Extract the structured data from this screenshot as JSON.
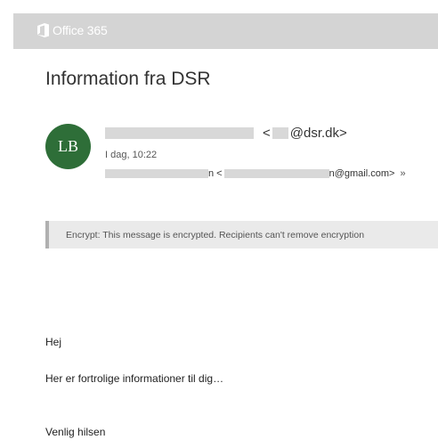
{
  "topbar": {
    "brand": "Office 365",
    "background": "#d4d4d4"
  },
  "message": {
    "subject": "Information fra DSR",
    "avatar_initials": "LB",
    "avatar_color": "#2e6e38",
    "sender_open": "<",
    "sender_domain": "@dsr.dk>",
    "date": "I dag, 10:22",
    "recipient_open": "n <",
    "recipient_domain": "n@gmail.com>",
    "expand_icon": "chevron-double-down-icon",
    "encrypt_notice": "Encrypt: This message is encrypted. Recipients can't remove encryption",
    "body": {
      "greeting": "Hej",
      "line1": "Her er fortrolige informationer til dig…",
      "closing": "Venlig hilsen"
    }
  }
}
